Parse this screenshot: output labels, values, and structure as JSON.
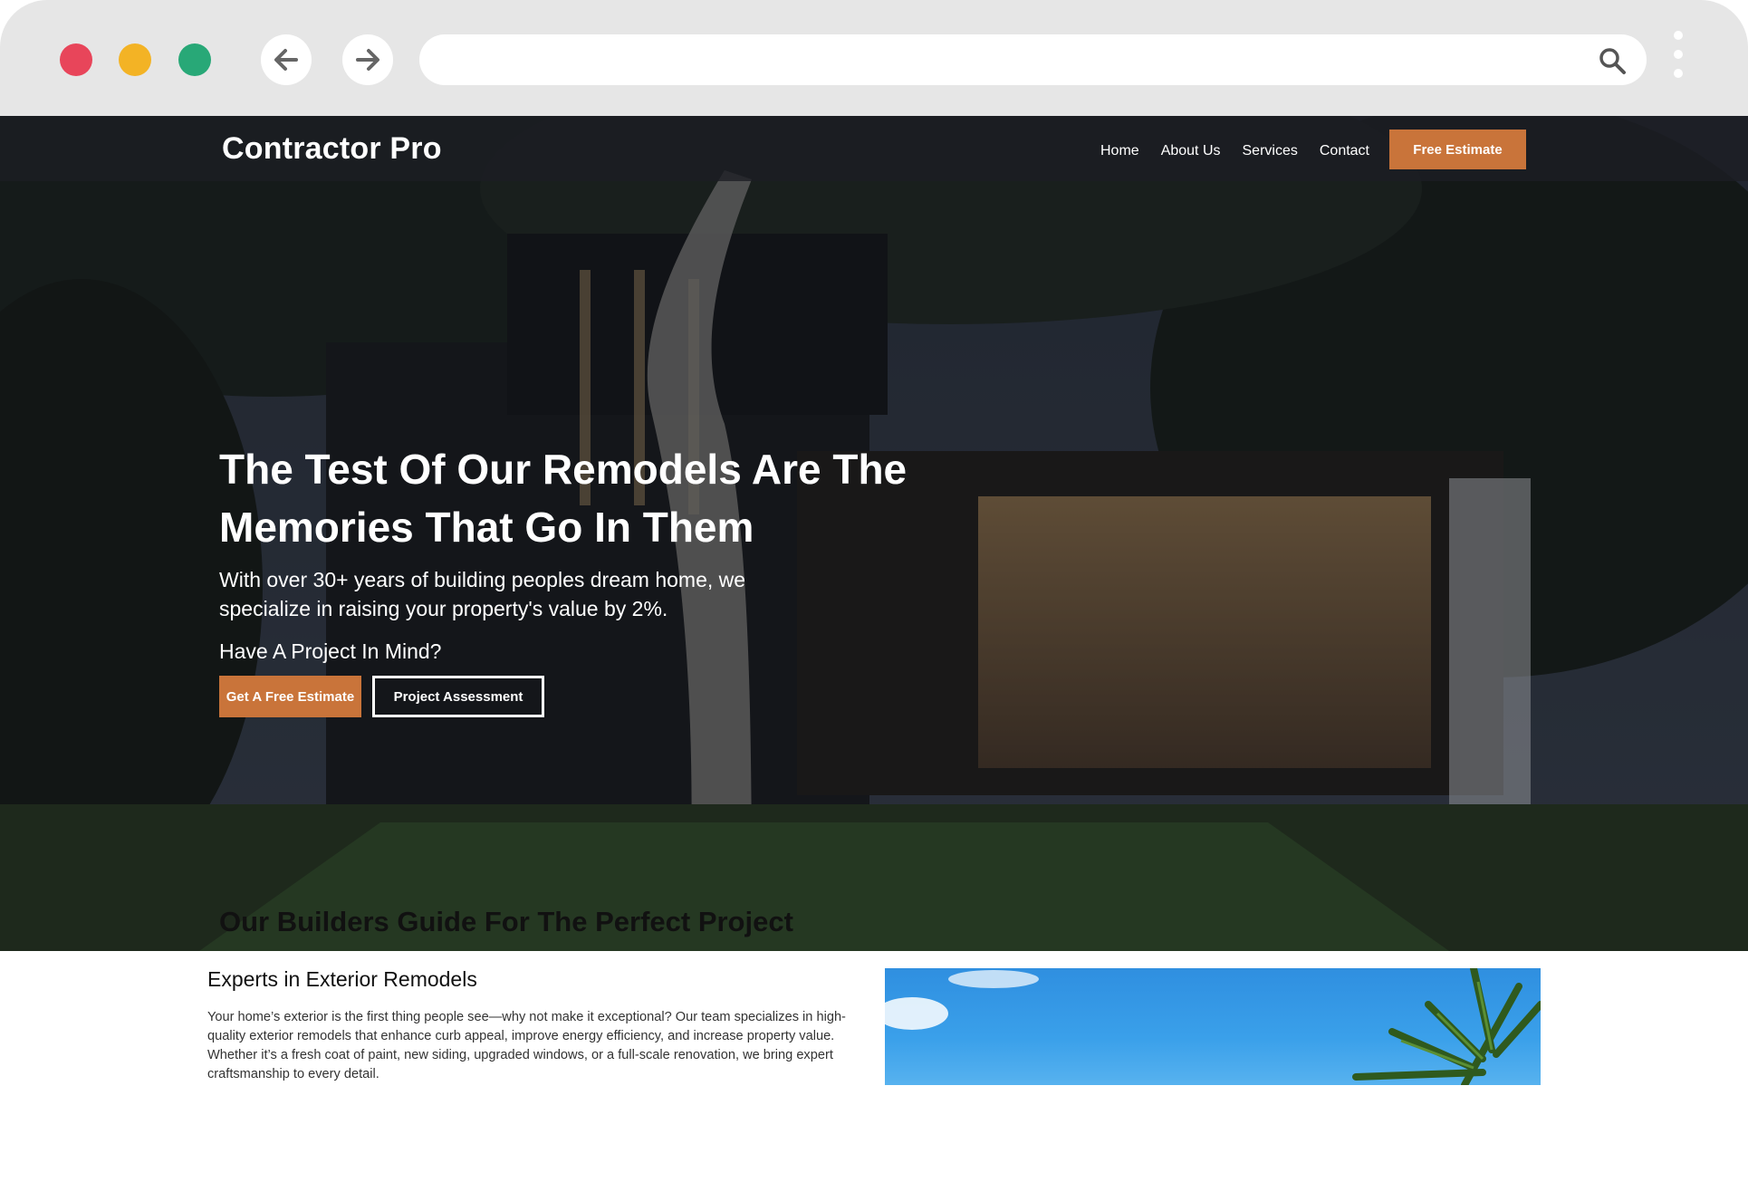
{
  "browser": {
    "address_value": "",
    "icons": [
      "back-arrow-icon",
      "forward-arrow-icon",
      "search-icon",
      "kebab-menu-icon"
    ]
  },
  "site": {
    "brand": "Contractor Pro",
    "nav": [
      {
        "label": "Home"
      },
      {
        "label": "About Us"
      },
      {
        "label": "Services"
      },
      {
        "label": "Contact"
      }
    ],
    "nav_cta": "Free Estimate",
    "hero": {
      "title": "The Test Of Our Remodels Are The Memories That Go In Them",
      "subtitle": "With over 30+ years of building peoples dream home, we specialize in raising your property's value by 2%.",
      "ask": "Have A Project In Mind?",
      "primary_button": "Get A Free Estimate",
      "secondary_button": "Project Assessment"
    },
    "guide": {
      "title": "Our Builders Guide For The Perfect Project",
      "section_title": "Experts in Exterior Remodels",
      "section_body": "Your home’s exterior is the first thing people see—why not make it exceptional? Our team specializes in high-quality exterior remodels that enhance curb appeal, improve energy efficiency, and increase property value. Whether it’s a fresh coat of paint, new siding, upgraded windows, or a full-scale renovation, we bring expert craftsmanship to every detail."
    }
  },
  "colors": {
    "accent": "#c9743a",
    "chrome": "#e6e6e6",
    "traffic_red": "#e8455a",
    "traffic_yellow": "#f3b325",
    "traffic_green": "#28a877"
  }
}
